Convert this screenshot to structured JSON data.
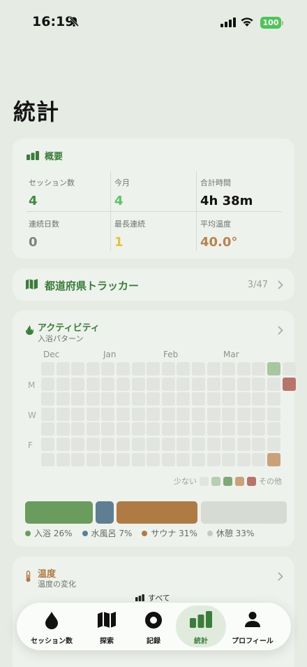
{
  "status": {
    "time": "16:19",
    "battery": "100"
  },
  "page": {
    "title": "統計"
  },
  "overview": {
    "title": "概要",
    "stats": [
      {
        "label": "セッション数",
        "value": "4",
        "color": "#3f8a3f"
      },
      {
        "label": "今月",
        "value": "4",
        "color": "#5cc45e"
      },
      {
        "label": "合計時間",
        "value": "4h 38m",
        "color": "#111111"
      },
      {
        "label": "連続日数",
        "value": "0",
        "color": "#7d827a"
      },
      {
        "label": "最長連続",
        "value": "1",
        "color": "#e6c23a"
      },
      {
        "label": "平均温度",
        "value": "40.0°",
        "color": "#b8834d"
      }
    ]
  },
  "tracker": {
    "label": "都道府県トラッカー",
    "count": "3/47"
  },
  "activity": {
    "title": "アクティビティ",
    "subtitle": "入浴パターン",
    "months": [
      "Dec",
      "Jan",
      "Feb",
      "Mar"
    ],
    "days": [
      "M",
      "W",
      "F"
    ],
    "legend_less": "少ない",
    "legend_more": "その他",
    "legend_colors": [
      "#e2e5df",
      "#b7cfb0",
      "#7fa878",
      "#c9a27a",
      "#b8746a"
    ],
    "highlights": [
      {
        "col": 15,
        "row": 0,
        "color": "#a9c6a0"
      },
      {
        "col": 16,
        "row": 1,
        "color": "#b8746a"
      },
      {
        "col": 15,
        "row": 6,
        "color": "#c9a27a"
      }
    ],
    "breakdown": [
      {
        "label": "入浴 26%",
        "percent": 26,
        "color": "#6a9c5e"
      },
      {
        "label": "水風呂 7%",
        "percent": 7,
        "color": "#5e7f93"
      },
      {
        "label": "サウナ 31%",
        "percent": 31,
        "color": "#b07a45"
      },
      {
        "label": "休憩 33%",
        "percent": 33,
        "color": "#d6dbd3"
      }
    ]
  },
  "temperature": {
    "title": "温度",
    "subtitle": "温度の変化",
    "filter": "すべて"
  },
  "tabs": [
    {
      "label": "セッション数",
      "icon": "drop-icon",
      "active": false
    },
    {
      "label": "探索",
      "icon": "map-icon",
      "active": false
    },
    {
      "label": "記録",
      "icon": "record-icon",
      "active": false
    },
    {
      "label": "統計",
      "icon": "chart-icon",
      "active": true
    },
    {
      "label": "プロフィール",
      "icon": "person-icon",
      "active": false
    }
  ]
}
